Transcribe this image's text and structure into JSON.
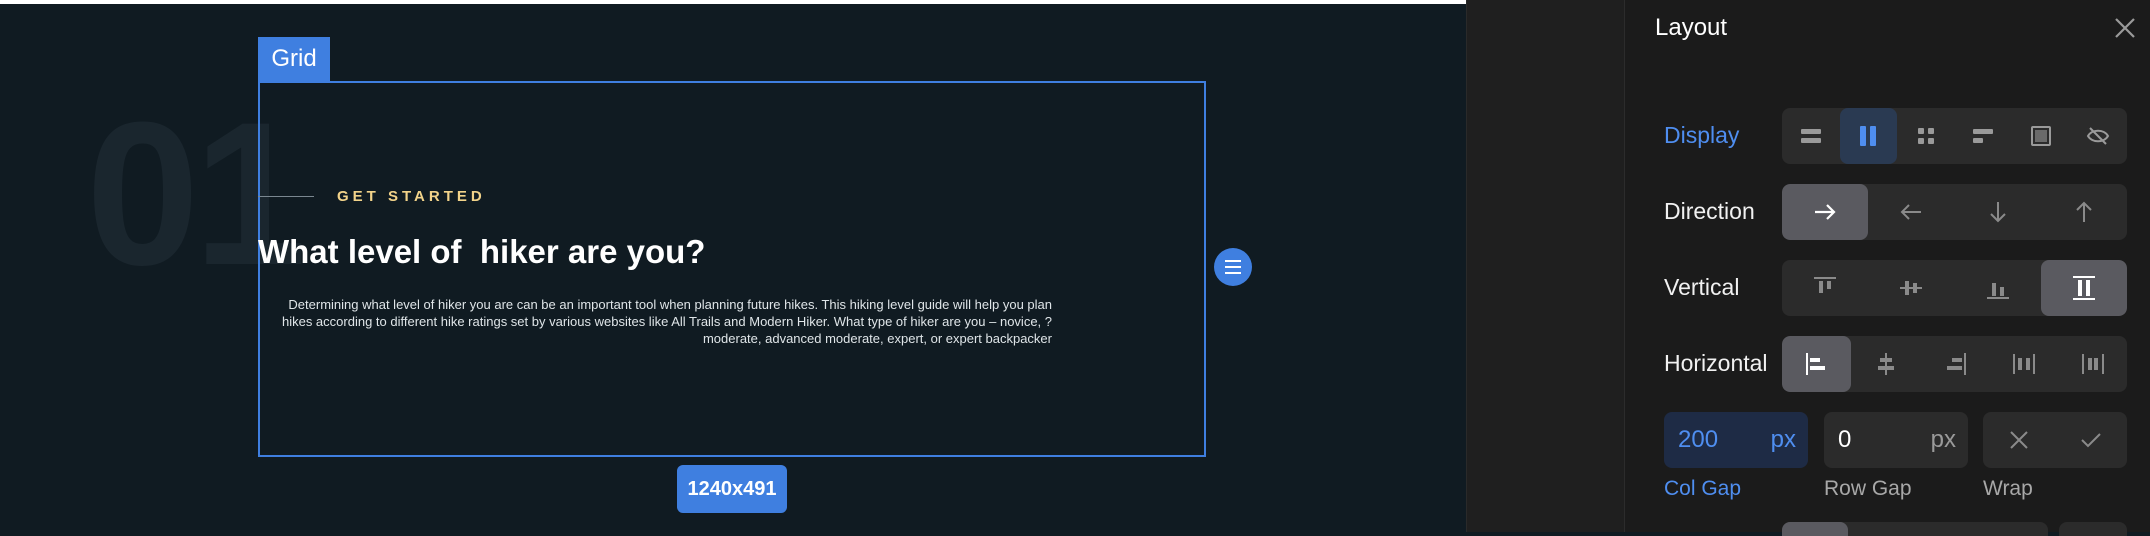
{
  "canvas": {
    "bg_number": "01",
    "grid_tag": "Grid",
    "eyebrow": "GET STARTED",
    "headline": "What level of  hiker are you?",
    "body_text": "Determining what level of hiker you are can be an important tool when planning future hikes. This hiking level guide will help you plan hikes according to different hike ratings set by various websites like All Trails and Modern Hiker. What type of hiker are you – novice, ?moderate, advanced moderate, expert, or expert backpacker",
    "size_badge": "1240x491"
  },
  "panel": {
    "title": "Layout",
    "display": {
      "label": "Display",
      "options": [
        "block-icon",
        "flex-icon",
        "grid-icon",
        "inline-icon",
        "box-icon",
        "hidden-eye-icon"
      ],
      "selected": 1
    },
    "direction": {
      "label": "Direction",
      "options": [
        "arrow-right-icon",
        "arrow-left-icon",
        "arrow-down-icon",
        "arrow-up-icon"
      ],
      "selected": 0
    },
    "vertical": {
      "label": "Vertical",
      "options": [
        "align-top-icon",
        "align-middle-icon",
        "align-bottom-icon",
        "stretch-vertical-icon"
      ],
      "selected": 3
    },
    "horizontal": {
      "label": "Horizontal",
      "options": [
        "align-left-icon",
        "align-center-icon",
        "align-right-icon",
        "space-between-icon",
        "space-around-icon"
      ],
      "selected": 0
    },
    "col_gap": {
      "label": "Col Gap",
      "value": "200",
      "unit": "px"
    },
    "row_gap": {
      "label": "Row Gap",
      "value": "0",
      "unit": "px"
    },
    "wrap": {
      "label": "Wrap",
      "options": [
        "no-wrap-x-icon",
        "wrap-check-icon"
      ]
    }
  },
  "colors": {
    "accent": "#3f7fe0",
    "eyebrow": "#f2d38a",
    "canvas_bg": "#101b22",
    "panel_bg": "#1b1b1b"
  }
}
